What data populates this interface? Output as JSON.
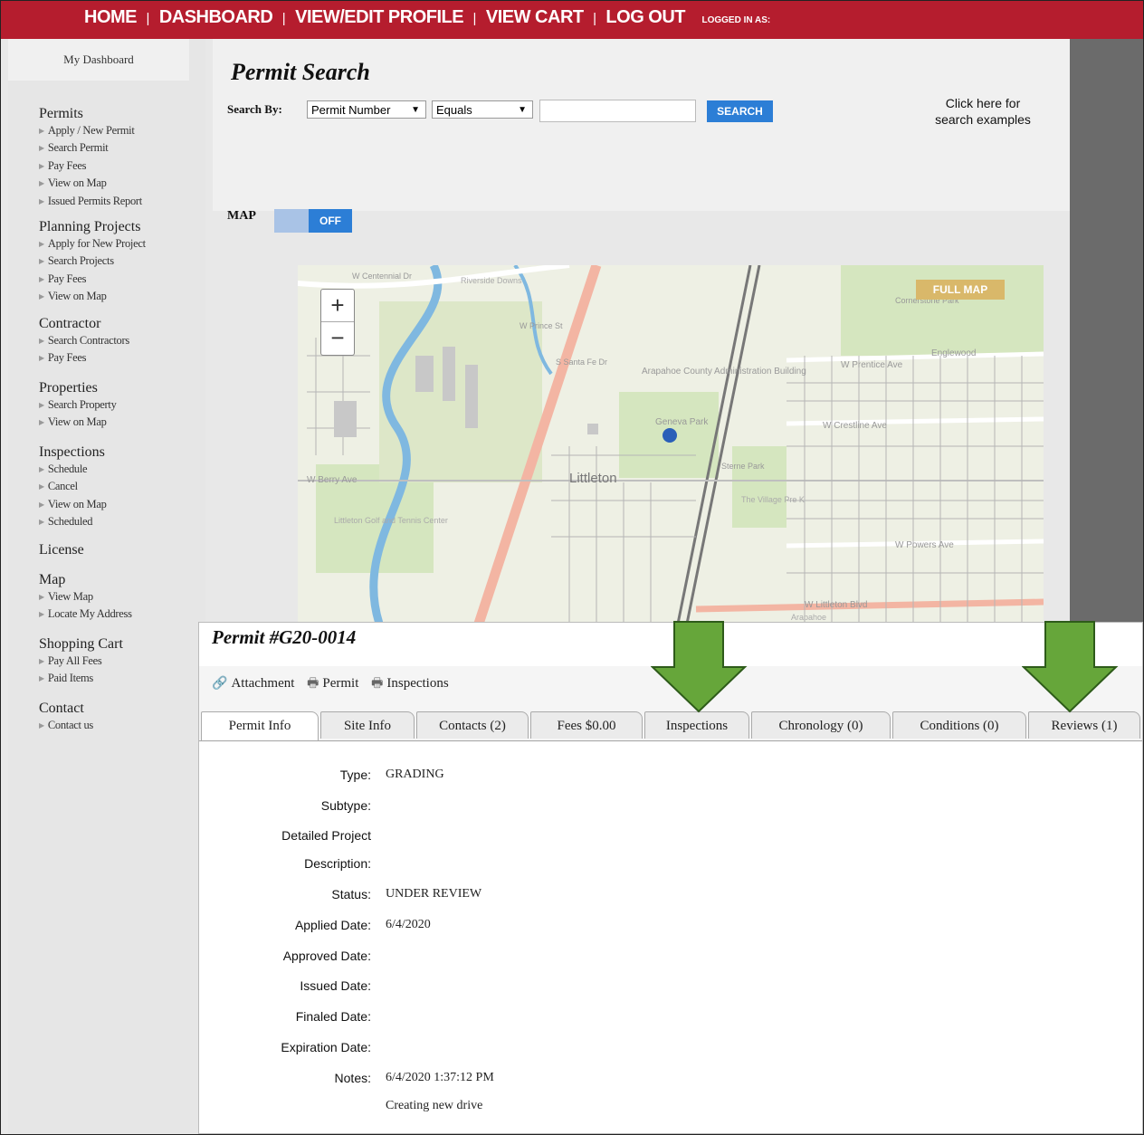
{
  "nav": {
    "home": "HOME",
    "dashboard": "DASHBOARD",
    "profile": "VIEW/EDIT PROFILE",
    "cart": "VIEW CART",
    "logout": "LOG OUT",
    "logged_in": "LOGGED IN AS:",
    "separator": "|"
  },
  "sidebar": {
    "dashboard": "My Dashboard",
    "sections": [
      {
        "title": "Permits",
        "items": [
          "Apply / New Permit",
          "Search Permit",
          "Pay Fees",
          "View on Map",
          "Issued Permits Report"
        ]
      },
      {
        "title": "Planning Projects",
        "items": [
          "Apply for New Project",
          "Search Projects",
          "Pay Fees",
          "View on Map"
        ]
      },
      {
        "title": "Contractor",
        "items": [
          "Search Contractors",
          "Pay Fees"
        ]
      },
      {
        "title": "Properties",
        "items": [
          "Search Property",
          "View on Map"
        ]
      },
      {
        "title": "Inspections",
        "items": [
          "Schedule",
          "Cancel",
          "View on Map",
          "Scheduled"
        ]
      },
      {
        "title": "License",
        "items": []
      },
      {
        "title": "Map",
        "items": [
          "View Map",
          "Locate My Address"
        ]
      },
      {
        "title": "Shopping Cart",
        "items": [
          "Pay All Fees",
          "Paid Items"
        ]
      },
      {
        "title": "Contact",
        "items": [
          "Contact us"
        ]
      }
    ]
  },
  "search": {
    "title": "Permit Search",
    "search_by_label": "Search By:",
    "field_select": "Permit Number",
    "operator_select": "Equals",
    "input_value": "",
    "button": "SEARCH",
    "examples_line1": "Click here for",
    "examples_line2": "search examples",
    "map_label": "MAP",
    "map_toggle_state": "OFF",
    "caret": "▼"
  },
  "map": {
    "full_map": "FULL MAP",
    "zoom_in": "+",
    "zoom_out": "−",
    "labels": [
      "W Centennial Dr",
      "Riverside Downs",
      "W Prince St",
      "S Santa Fe Dr",
      "Arapahoe County Administration Building",
      "Cornerstone Park",
      "Englewood",
      "W Prentice Ave",
      "Geneva Park",
      "W Crestline Ave",
      "Littleton",
      "Sterne Park",
      "W Berry Ave",
      "Littleton Golf and Tennis Center",
      "The Village Pre K",
      "W Powers Ave",
      "W Littleton Blvd",
      "Arapahoe"
    ],
    "colors": {
      "water": "#7fb8e0",
      "park": "#d5e6bf",
      "road": "#f3b5a3",
      "rail": "#777777"
    }
  },
  "permit": {
    "title": "Permit #G20-0014",
    "actions": {
      "attachment": "Attachment",
      "permit": "Permit",
      "inspections": "Inspections"
    },
    "tabs": [
      "Permit Info",
      "Site Info",
      "Contacts (2)",
      "Fees $0.00",
      "Inspections",
      "Chronology (0)",
      "Conditions (0)",
      "Reviews (1)"
    ],
    "fields": [
      {
        "label": "Type:",
        "value": "GRADING"
      },
      {
        "label": "Subtype:",
        "value": ""
      },
      {
        "label": "Detailed Project",
        "value": ""
      },
      {
        "label": "Description:",
        "value": ""
      },
      {
        "label": "Status:",
        "value": "UNDER REVIEW"
      },
      {
        "label": "Applied Date:",
        "value": "6/4/2020"
      },
      {
        "label": "Approved Date:",
        "value": ""
      },
      {
        "label": "Issued Date:",
        "value": ""
      },
      {
        "label": "Finaled Date:",
        "value": ""
      },
      {
        "label": "Expiration Date:",
        "value": ""
      },
      {
        "label": "Notes:",
        "value": "6/4/2020 1:37:12 PM"
      },
      {
        "label": "",
        "value": "Creating new drive"
      }
    ]
  },
  "colors": {
    "brand_red": "#b51d2e",
    "accent_blue": "#2c7ed6",
    "arrow_green": "#66a63a"
  }
}
